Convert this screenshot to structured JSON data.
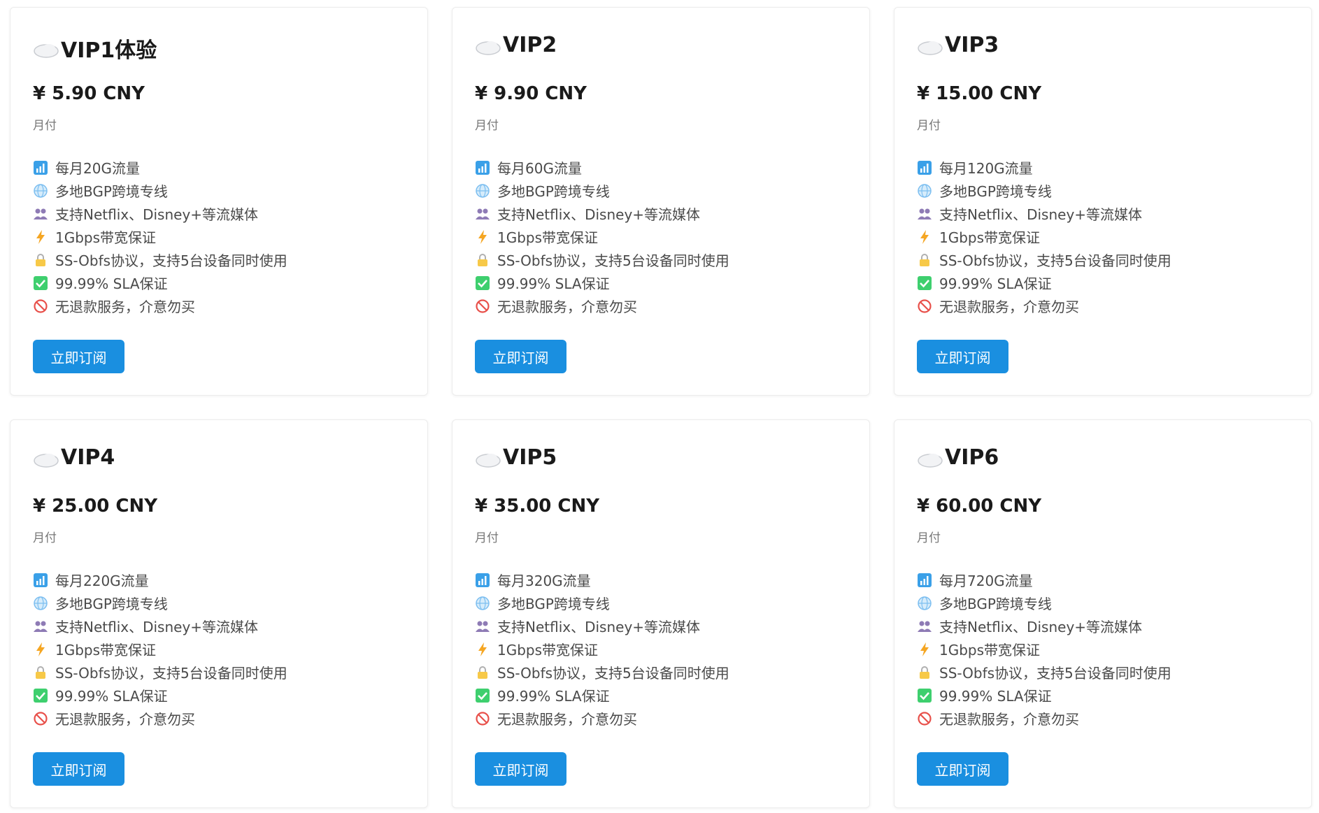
{
  "plans": [
    {
      "title": "VIP1体验",
      "price": "¥ 5.90 CNY",
      "period": "月付",
      "traffic": "每月20G流量",
      "button": "立即订阅"
    },
    {
      "title": "VIP2",
      "price": "¥ 9.90 CNY",
      "period": "月付",
      "traffic": "每月60G流量",
      "button": "立即订阅"
    },
    {
      "title": "VIP3",
      "price": "¥ 15.00 CNY",
      "period": "月付",
      "traffic": "每月120G流量",
      "button": "立即订阅"
    },
    {
      "title": "VIP4",
      "price": "¥ 25.00 CNY",
      "period": "月付",
      "traffic": "每月220G流量",
      "button": "立即订阅"
    },
    {
      "title": "VIP5",
      "price": "¥ 35.00 CNY",
      "period": "月付",
      "traffic": "每月320G流量",
      "button": "立即订阅"
    },
    {
      "title": "VIP6",
      "price": "¥ 60.00 CNY",
      "period": "月付",
      "traffic": "每月720G流量",
      "button": "立即订阅"
    }
  ],
  "shared_features": {
    "bgp": "多地BGP跨境专线",
    "streaming": "支持Netflix、Disney+等流媒体",
    "bandwidth": "1Gbps带宽保证",
    "protocol": "SS-Obfs协议，支持5台设备同时使用",
    "sla": "99.99% SLA保证",
    "refund": "无退款服务，介意勿买"
  },
  "colors": {
    "accent": "#1a8fe0",
    "title": "#1a1a1a",
    "muted": "#777777"
  },
  "icons": {
    "title": "cloud-icon",
    "traffic": "bar-chart-icon",
    "bgp": "globe-icon",
    "streaming": "people-icon",
    "bandwidth": "lightning-icon",
    "protocol": "lock-icon",
    "sla": "check-mark-icon",
    "refund": "prohibited-icon"
  }
}
